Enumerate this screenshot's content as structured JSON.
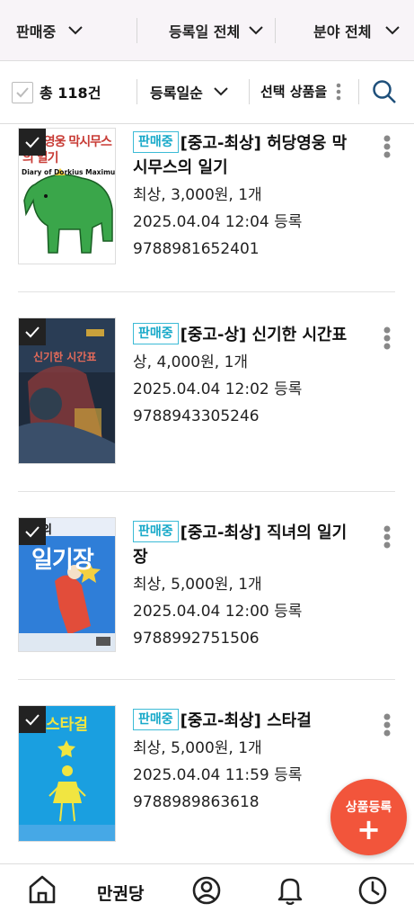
{
  "filters": [
    {
      "label": "판매중"
    },
    {
      "label": "등록일 전체"
    },
    {
      "label": "분야 전체"
    }
  ],
  "toolbar": {
    "total": "총 118건",
    "sort": "등록일순",
    "select_action": "선택 상품을"
  },
  "products": [
    {
      "status": "판매중",
      "title": "[중고-최상] 허당영웅 막시무스의 일기",
      "condition_price": "최상, 3,000원, 1개",
      "date": "2025.04.04 12:04 등록",
      "isbn": "9788981652401",
      "cover": {
        "title": "허당영웅 막시무스의 일기",
        "subtitle": "Diary of Dorkius Maximus",
        "colors": [
          "#ffffff",
          "#c83c36",
          "#3aa64a"
        ]
      }
    },
    {
      "status": "판매중",
      "title": "[중고-상] 신기한 시간표",
      "condition_price": "상, 4,000원, 1개",
      "date": "2025.04.04 12:02 등록",
      "isbn": "9788943305246",
      "cover": {
        "title": "신기한 시간표",
        "colors": [
          "#1e2b3c",
          "#8a3a3a",
          "#c9a13b"
        ]
      }
    },
    {
      "status": "판매중",
      "title": "[중고-최상] 직녀의 일기장",
      "condition_price": "최상, 5,000원, 1개",
      "date": "2025.04.04 12:00 등록",
      "isbn": "9788992751506",
      "cover": {
        "title": "일기장",
        "prefix": "의",
        "colors": [
          "#2f7ed8",
          "#e24d3a",
          "#f4d040"
        ]
      }
    },
    {
      "status": "판매중",
      "title": "[중고-최상] 스타걸",
      "condition_price": "최상, 5,000원, 1개",
      "date": "2025.04.04 11:59 등록",
      "isbn": "9788989863618",
      "cover": {
        "title": "스타걸",
        "colors": [
          "#1a9fe0",
          "#f1e541",
          "#46a8e6"
        ]
      }
    }
  ],
  "fab": {
    "label": "상품등록",
    "plus": "+"
  },
  "bottom_nav": {
    "store_label": "만권당",
    "icons": [
      "home-icon",
      "user-icon",
      "bell-icon",
      "clock-icon"
    ]
  },
  "colors": {
    "accent": "#f2553b",
    "badge": "#18a9c9",
    "header_bg": "#f8f4f8",
    "search": "#1e4f7a"
  }
}
